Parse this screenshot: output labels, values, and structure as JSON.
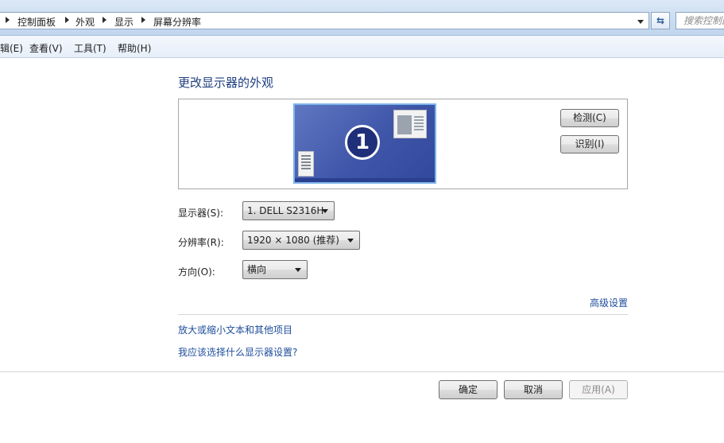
{
  "breadcrumb": {
    "items": [
      "控制面板",
      "外观",
      "显示",
      "屏幕分辨率"
    ]
  },
  "search": {
    "placeholder": "搜索控制面板"
  },
  "menu": {
    "items": [
      "辑(E)",
      "查看(V)",
      "工具(T)",
      "帮助(H)"
    ]
  },
  "main": {
    "title": "更改显示器的外观",
    "monitor_number": "1",
    "detect_label": "检测(C)",
    "identify_label": "识别(I)",
    "display_label": "显示器(S):",
    "display_value": "1. DELL S2316H",
    "resolution_label": "分辨率(R):",
    "resolution_value": "1920 × 1080 (推荐)",
    "orientation_label": "方向(O):",
    "orientation_value": "横向",
    "advanced_link": "高级设置",
    "link_text_size": "放大或缩小文本和其他项目",
    "link_which_settings": "我应该选择什么显示器设置?"
  },
  "buttons": {
    "ok": "确定",
    "cancel": "取消",
    "apply": "应用(A)"
  },
  "colors": {
    "link": "#1e4d9b",
    "title": "#1e3e7e",
    "monitor_bg": "#3f55a8"
  }
}
